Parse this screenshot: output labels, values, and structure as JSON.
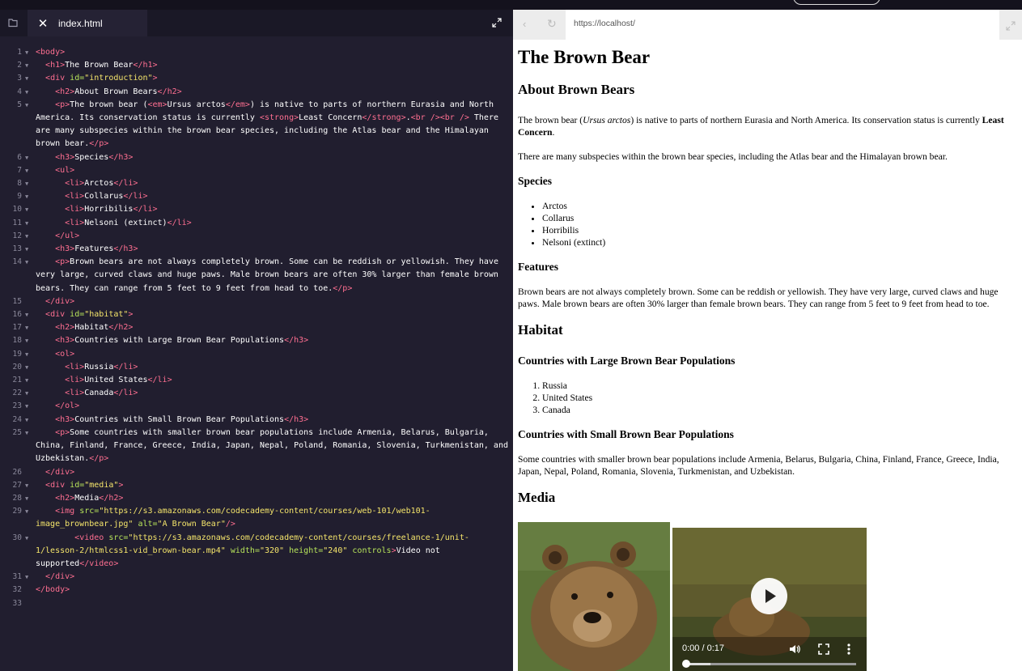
{
  "editor": {
    "tab_title": "index.html",
    "close_glyph": "✕",
    "folder_icon": "folder-icon",
    "expand_icon": "expand-icon"
  },
  "code_lines": [
    {
      "n": "1",
      "fold": true,
      "html": "<span class=\"t\">&lt;body&gt;</span>"
    },
    {
      "n": "2",
      "fold": true,
      "html": "  <span class=\"t\">&lt;h1&gt;</span>The Brown Bear<span class=\"t\">&lt;/h1&gt;</span>"
    },
    {
      "n": "3",
      "fold": true,
      "html": "  <span class=\"t\">&lt;div</span> <span class=\"a\">id=</span><span class=\"s\">\"introduction\"</span><span class=\"t\">&gt;</span>"
    },
    {
      "n": "4",
      "fold": true,
      "html": "    <span class=\"t\">&lt;h2&gt;</span>About Brown Bears<span class=\"t\">&lt;/h2&gt;</span>"
    },
    {
      "n": "5",
      "fold": true,
      "html": "    <span class=\"t\">&lt;p&gt;</span>The brown bear (<span class=\"t\">&lt;em&gt;</span>Ursus arctos<span class=\"t\">&lt;/em&gt;</span>) is native to parts of northern Eurasia and North America. Its conservation status is currently <span class=\"t\">&lt;strong&gt;</span>Least Concern<span class=\"t\">&lt;/strong&gt;</span>.<span class=\"t\">&lt;br /&gt;&lt;br /&gt;</span> There are many subspecies within the brown bear species, including the Atlas bear and the Himalayan brown bear.<span class=\"t\">&lt;/p&gt;</span>"
    },
    {
      "n": "6",
      "fold": true,
      "html": "    <span class=\"t\">&lt;h3&gt;</span>Species<span class=\"t\">&lt;/h3&gt;</span>"
    },
    {
      "n": "7",
      "fold": true,
      "html": "    <span class=\"t\">&lt;ul&gt;</span>"
    },
    {
      "n": "8",
      "fold": true,
      "html": "      <span class=\"t\">&lt;li&gt;</span>Arctos<span class=\"t\">&lt;/li&gt;</span>"
    },
    {
      "n": "9",
      "fold": true,
      "html": "      <span class=\"t\">&lt;li&gt;</span>Collarus<span class=\"t\">&lt;/li&gt;</span>"
    },
    {
      "n": "10",
      "fold": true,
      "html": "      <span class=\"t\">&lt;li&gt;</span>Horribilis<span class=\"t\">&lt;/li&gt;</span>"
    },
    {
      "n": "11",
      "fold": true,
      "html": "      <span class=\"t\">&lt;li&gt;</span>Nelsoni (extinct)<span class=\"t\">&lt;/li&gt;</span>"
    },
    {
      "n": "12",
      "fold": true,
      "html": "    <span class=\"t\">&lt;/ul&gt;</span>"
    },
    {
      "n": "13",
      "fold": true,
      "html": "    <span class=\"t\">&lt;h3&gt;</span>Features<span class=\"t\">&lt;/h3&gt;</span>"
    },
    {
      "n": "14",
      "fold": true,
      "html": "    <span class=\"t\">&lt;p&gt;</span>Brown bears are not always completely brown. Some can be reddish or yellowish. They have very large, curved claws and huge paws. Male brown bears are often 30% larger than female brown bears. They can range from 5 feet to 9 feet from head to toe.<span class=\"t\">&lt;/p&gt;</span>"
    },
    {
      "n": "15",
      "fold": false,
      "html": "  <span class=\"t\">&lt;/div&gt;</span>"
    },
    {
      "n": "16",
      "fold": true,
      "html": "  <span class=\"t\">&lt;div</span> <span class=\"a\">id=</span><span class=\"s\">\"habitat\"</span><span class=\"t\">&gt;</span>"
    },
    {
      "n": "17",
      "fold": true,
      "html": "    <span class=\"t\">&lt;h2&gt;</span>Habitat<span class=\"t\">&lt;/h2&gt;</span>"
    },
    {
      "n": "18",
      "fold": true,
      "html": "    <span class=\"t\">&lt;h3&gt;</span>Countries with Large Brown Bear Populations<span class=\"t\">&lt;/h3&gt;</span>"
    },
    {
      "n": "19",
      "fold": true,
      "html": "    <span class=\"t\">&lt;ol&gt;</span>"
    },
    {
      "n": "20",
      "fold": true,
      "html": "      <span class=\"t\">&lt;li&gt;</span>Russia<span class=\"t\">&lt;/li&gt;</span>"
    },
    {
      "n": "21",
      "fold": true,
      "html": "      <span class=\"t\">&lt;li&gt;</span>United States<span class=\"t\">&lt;/li&gt;</span>"
    },
    {
      "n": "22",
      "fold": true,
      "html": "      <span class=\"t\">&lt;li&gt;</span>Canada<span class=\"t\">&lt;/li&gt;</span>"
    },
    {
      "n": "23",
      "fold": true,
      "html": "    <span class=\"t\">&lt;/ol&gt;</span>"
    },
    {
      "n": "24",
      "fold": true,
      "html": "    <span class=\"t\">&lt;h3&gt;</span>Countries with Small Brown Bear Populations<span class=\"t\">&lt;/h3&gt;</span>"
    },
    {
      "n": "25",
      "fold": true,
      "html": "    <span class=\"t\">&lt;p&gt;</span>Some countries with smaller brown bear populations include Armenia, Belarus, Bulgaria, China, Finland, France, Greece, India, Japan, Nepal, Poland, Romania, Slovenia, Turkmenistan, and Uzbekistan.<span class=\"t\">&lt;/p&gt;</span>"
    },
    {
      "n": "26",
      "fold": false,
      "html": "  <span class=\"t\">&lt;/div&gt;</span>"
    },
    {
      "n": "27",
      "fold": true,
      "html": "  <span class=\"t\">&lt;div</span> <span class=\"a\">id=</span><span class=\"s\">\"media\"</span><span class=\"t\">&gt;</span>"
    },
    {
      "n": "28",
      "fold": true,
      "html": "    <span class=\"t\">&lt;h2&gt;</span>Media<span class=\"t\">&lt;/h2&gt;</span>"
    },
    {
      "n": "29",
      "fold": true,
      "html": "    <span class=\"t\">&lt;img</span> <span class=\"a\">src=</span><span class=\"s\">\"https://s3.amazonaws.com/codecademy-content/courses/web-101/web101-image_brownbear.jpg\"</span> <span class=\"a\">alt=</span><span class=\"s\">\"A Brown Bear\"</span><span class=\"t\">/&gt;</span>"
    },
    {
      "n": "30",
      "fold": true,
      "html": "        <span class=\"t\">&lt;video</span> <span class=\"a\">src=</span><span class=\"s\">\"https://s3.amazonaws.com/codecademy-content/courses/freelance-1/unit-1/lesson-2/htmlcss1-vid_brown-bear.mp4\"</span> <span class=\"a\">width=</span><span class=\"s\">\"320\"</span> <span class=\"a\">height=</span><span class=\"s\">\"240\"</span> <span class=\"a\">controls</span><span class=\"t\">&gt;</span>Video not supported<span class=\"t\">&lt;/video&gt;</span>"
    },
    {
      "n": "31",
      "fold": true,
      "html": "  <span class=\"t\">&lt;/div&gt;</span>"
    },
    {
      "n": "32",
      "fold": false,
      "html": "<span class=\"t\">&lt;/body&gt;</span>"
    },
    {
      "n": "33",
      "fold": false,
      "html": ""
    }
  ],
  "browser": {
    "back_glyph": "‹",
    "reload_glyph": "↻",
    "url": "https://localhost/",
    "expand_icon": "expand-icon"
  },
  "page": {
    "h1": "The Brown Bear",
    "about_h2": "About Brown Bears",
    "intro_p1_a": "The brown bear (",
    "intro_p1_em": "Ursus arctos",
    "intro_p1_b": ") is native to parts of northern Eurasia and North America. Its conservation status is currently ",
    "intro_p1_strong": "Least Concern",
    "intro_p1_c": ".",
    "intro_p2": "There are many subspecies within the brown bear species, including the Atlas bear and the Himalayan brown bear.",
    "species_h3": "Species",
    "species": [
      "Arctos",
      "Collarus",
      "Horribilis",
      "Nelsoni (extinct)"
    ],
    "features_h3": "Features",
    "features_p": "Brown bears are not always completely brown. Some can be reddish or yellowish. They have very large, curved claws and huge paws. Male brown bears are often 30% larger than female brown bears. They can range from 5 feet to 9 feet from head to toe.",
    "habitat_h2": "Habitat",
    "large_h3": "Countries with Large Brown Bear Populations",
    "large_countries": [
      "Russia",
      "United States",
      "Canada"
    ],
    "small_h3": "Countries with Small Brown Bear Populations",
    "small_p": "Some countries with smaller brown bear populations include Armenia, Belarus, Bulgaria, China, Finland, France, Greece, India, Japan, Nepal, Poland, Romania, Slovenia, Turkmenistan, and Uzbekistan.",
    "media_h2": "Media",
    "video_time": "0:00 / 0:17",
    "video_progress": 0.0
  }
}
